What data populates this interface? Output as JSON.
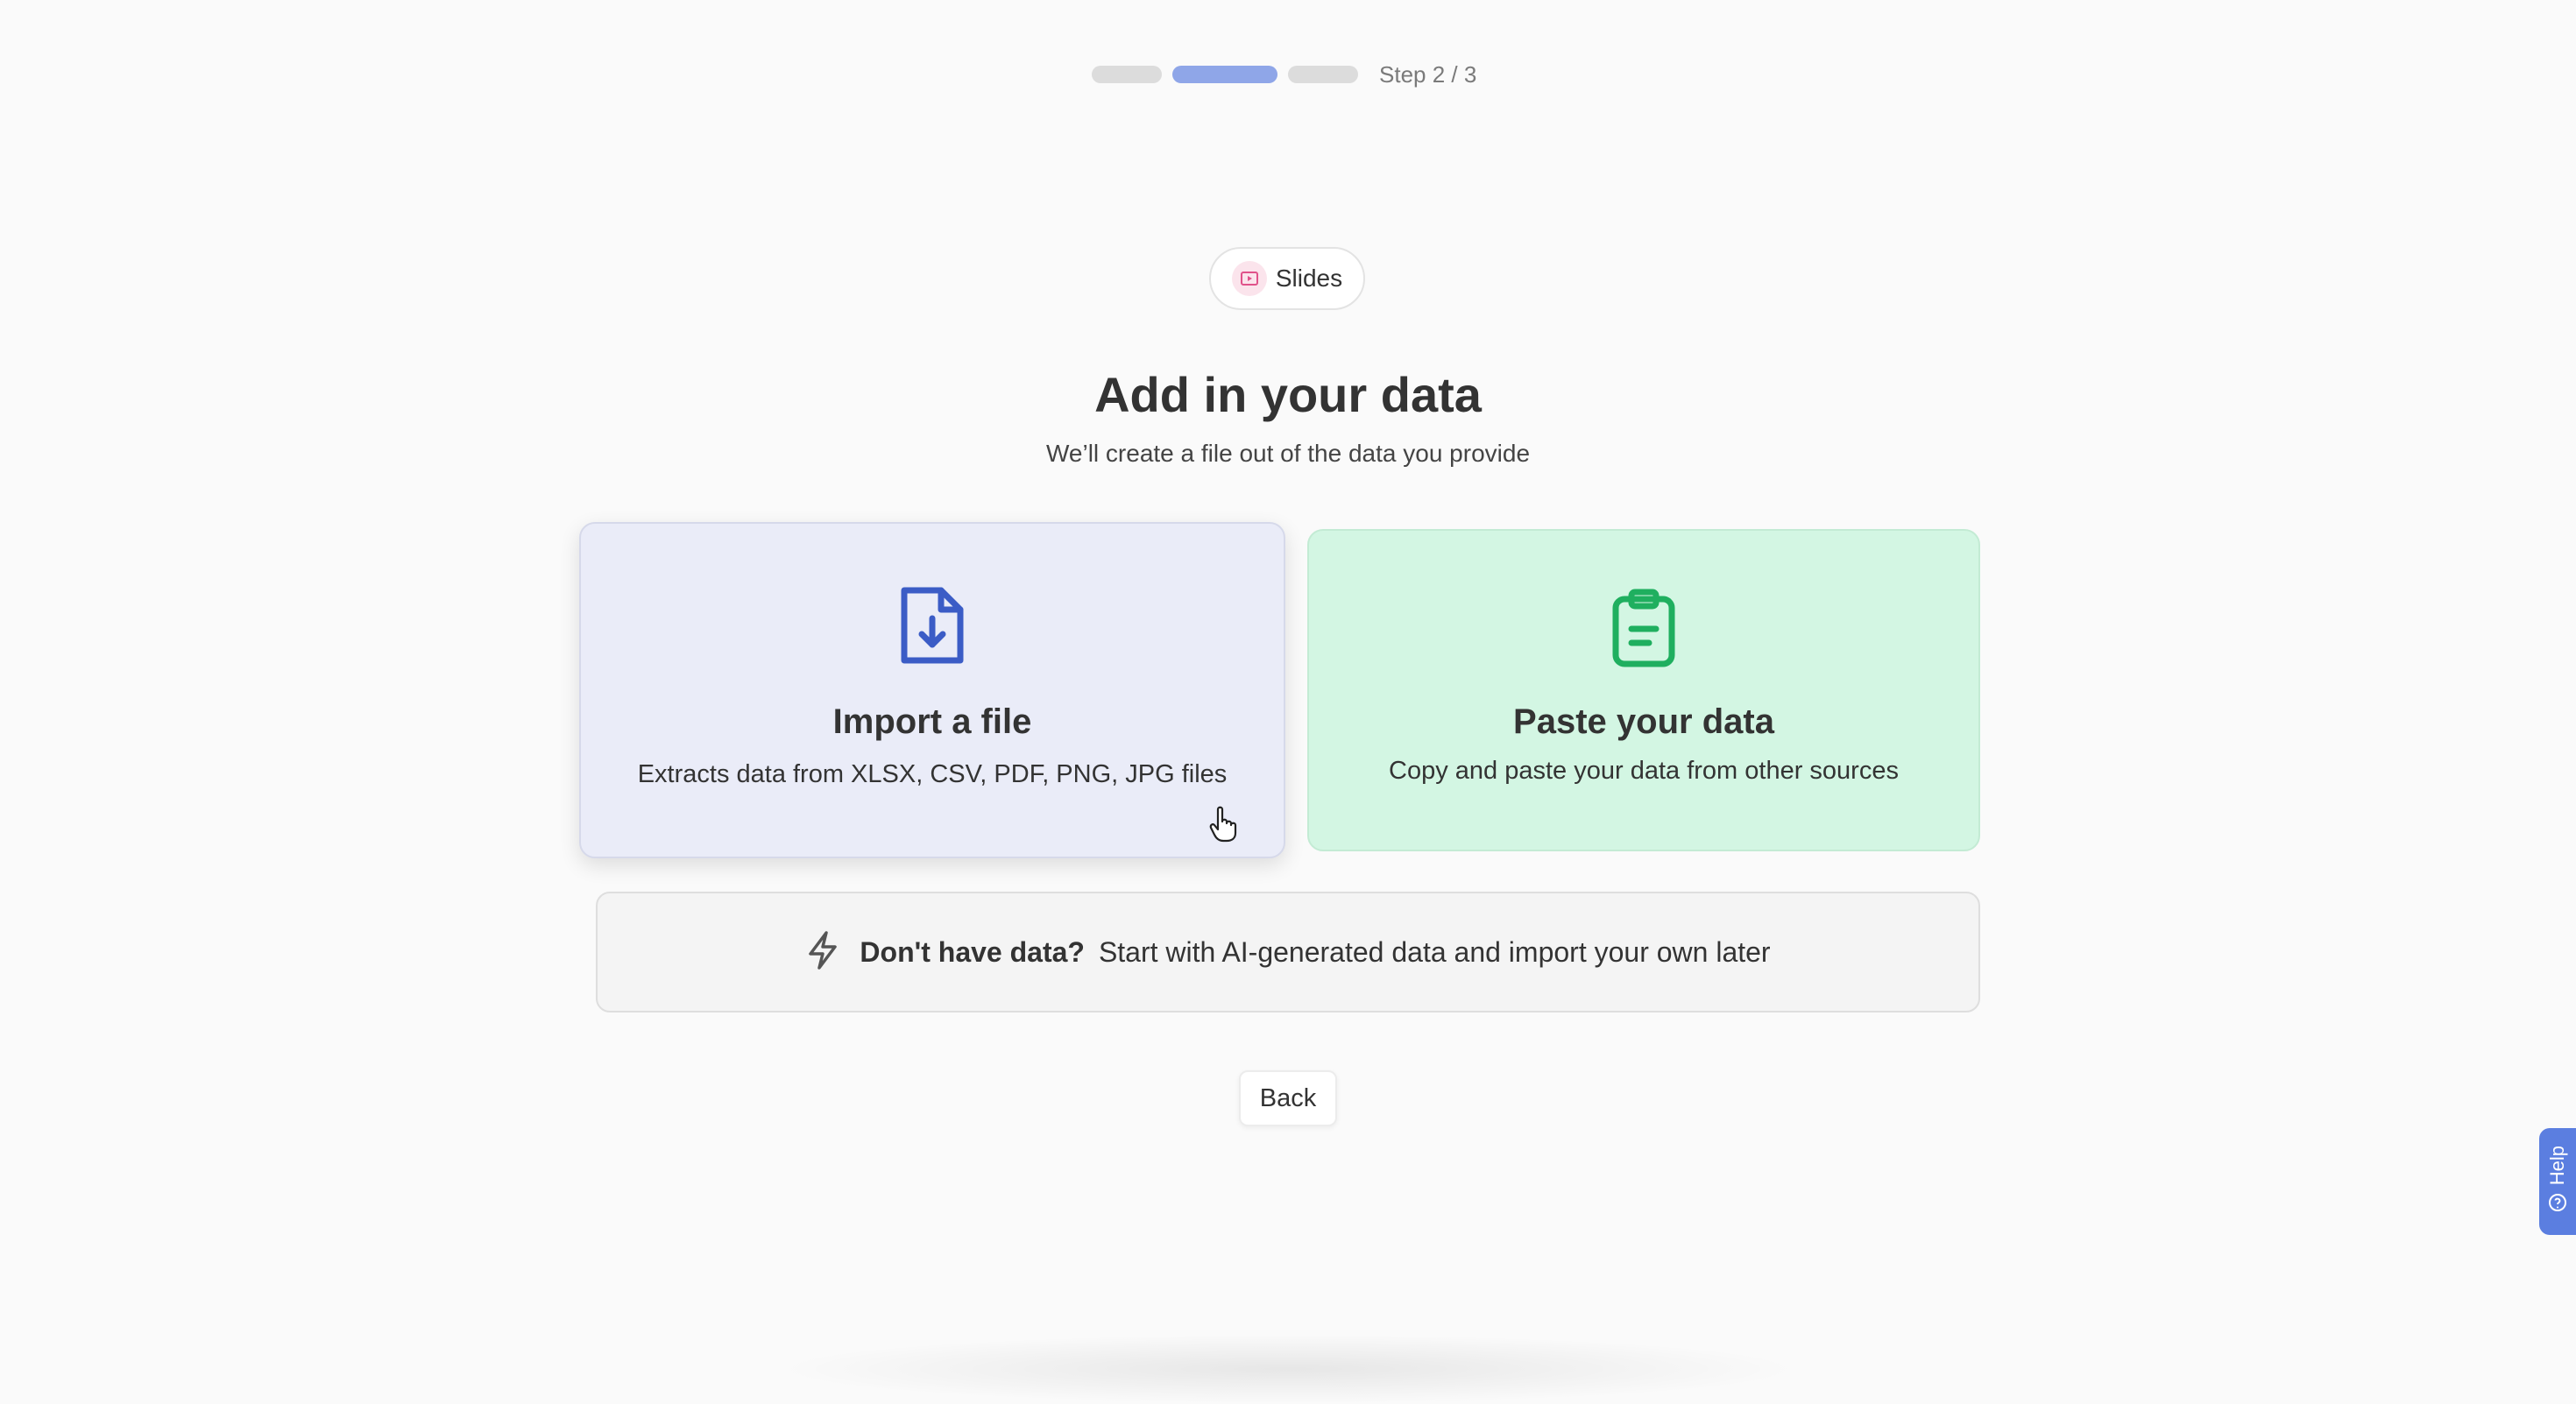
{
  "progress": {
    "step_label": "Step 2 / 3",
    "current_step": 2,
    "total_steps": 3
  },
  "chip": {
    "label": "Slides",
    "icon": "play-slides-icon",
    "icon_color": "#e0528a"
  },
  "header": {
    "title": "Add in your data",
    "subtitle": "We’ll create a file out of the data you provide"
  },
  "options": {
    "import": {
      "title": "Import a file",
      "description": "Extracts data from XLSX, CSV, PDF, PNG, JPG files",
      "icon": "file-download-icon",
      "accent": "#3b5cc6",
      "background": "#eaecf8"
    },
    "paste": {
      "title": "Paste your data",
      "description": "Copy and paste your data from other sources",
      "icon": "clipboard-icon",
      "accent": "#1faf5f",
      "background": "#d3f6e3"
    }
  },
  "ai_option": {
    "bold_text": "Don't have data?",
    "text": "Start with AI-generated data and import your own later",
    "icon": "lightning-icon"
  },
  "back_label": "Back",
  "help": {
    "label": "Help",
    "icon": "help-circle-icon",
    "color": "#5b7ee0"
  }
}
